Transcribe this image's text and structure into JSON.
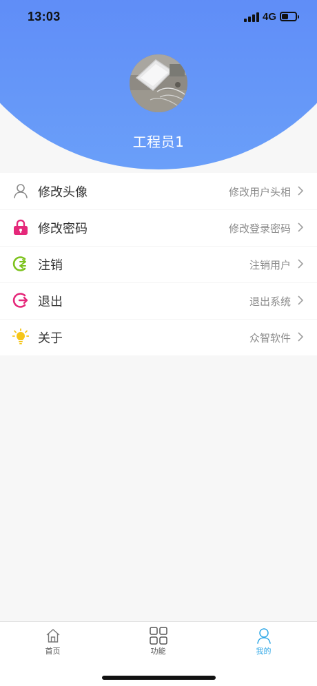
{
  "status_bar": {
    "time": "13:03",
    "network": "4G",
    "signal_icon": "cellular-signal-icon",
    "battery_icon": "battery-icon"
  },
  "profile": {
    "avatar": "avatar-photo",
    "name": "工程员1"
  },
  "menu": [
    {
      "label": "修改头像",
      "desc": "修改用户头相",
      "icon": "user-outline-icon",
      "color": "#8a8a8a"
    },
    {
      "label": "修改密码",
      "desc": "修改登录密码",
      "icon": "lock-icon",
      "color": "#e5287a"
    },
    {
      "label": "注销",
      "desc": "注销用户",
      "icon": "logoff-icon",
      "color": "#7cc21c"
    },
    {
      "label": "退出",
      "desc": "退出系统",
      "icon": "exit-icon",
      "color": "#e5287a"
    },
    {
      "label": "关于",
      "desc": "众智软件",
      "icon": "lightbulb-icon",
      "color": "#f5c518"
    }
  ],
  "tabbar": {
    "tabs": [
      {
        "label": "首页",
        "icon": "home-icon",
        "active": false
      },
      {
        "label": "功能",
        "icon": "grid-icon",
        "active": false
      },
      {
        "label": "我的",
        "icon": "user-icon",
        "active": true
      }
    ],
    "active_color": "#2ea7e6"
  },
  "colors": {
    "header_gradient_top": "#5a7df4",
    "header_gradient_bottom": "#6a9ff9"
  }
}
